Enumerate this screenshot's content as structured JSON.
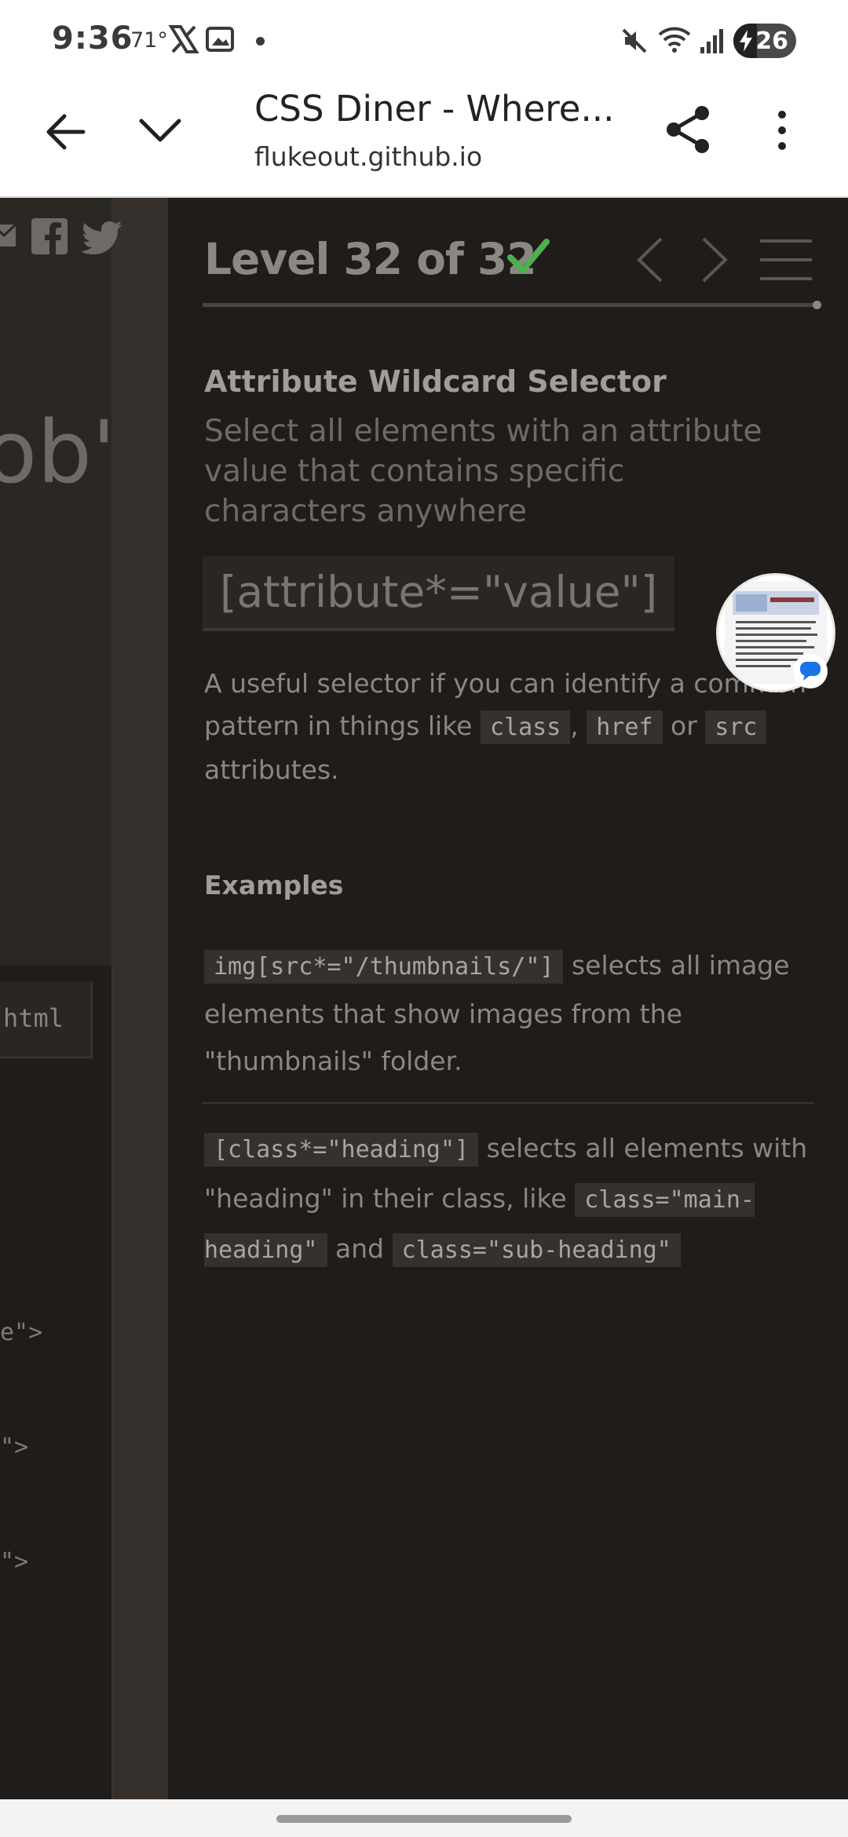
{
  "status_bar": {
    "time": "9:36",
    "temperature": "71°",
    "battery_level": "26"
  },
  "browser": {
    "page_title": "CSS Diner - Where...",
    "url": "flukeout.github.io"
  },
  "left_panel": {
    "big_text": "ob'",
    "editor_tab": "html",
    "code_lines": [
      "e\">",
      "\">",
      "\">"
    ]
  },
  "level": {
    "title": "Level 32 of 32",
    "completed": true,
    "progress": 1.0
  },
  "lesson": {
    "selector_name": "Attribute Wildcard Selector",
    "description": "Select all elements with an attribute value that contains specific characters anywhere",
    "syntax": "[attribute*=\"value\"]",
    "hint_prefix": "A useful selector if you can identify a common pattern in things like",
    "hint_code1": "class",
    "hint_sep1": ",",
    "hint_code2": "href",
    "hint_or": "or",
    "hint_code3": "src",
    "hint_suffix": "attributes."
  },
  "examples": {
    "heading": "Examples",
    "items": [
      {
        "code": "img[src*=\"/thumbnails/\"]",
        "text": "selects all image elements that show images from the \"thumbnails\" folder."
      },
      {
        "code": "[class*=\"heading\"]",
        "text_prefix": "selects all elements with \"heading\" in their class, like",
        "code2": "class=\"main-heading\"",
        "text_and": "and",
        "code3": "class=\"sub-heading\""
      }
    ]
  },
  "colors": {
    "background": "#1f1c19",
    "check_green": "#4caf50",
    "text_muted": "#8c8781"
  }
}
